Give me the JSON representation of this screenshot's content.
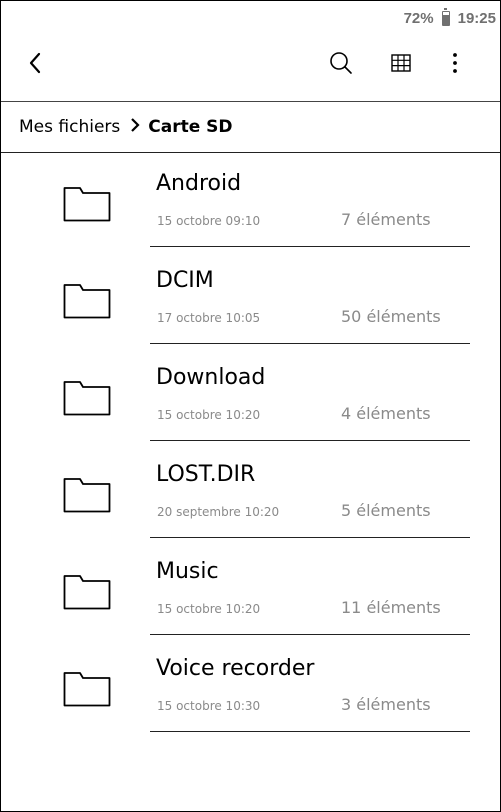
{
  "status_bar": {
    "battery": "72%",
    "time": "19:25"
  },
  "toolbar": {
    "back_icon": "chevron-left-icon",
    "search_icon": "search-icon",
    "view_icon": "grid-view-icon",
    "more_icon": "more-vertical-icon"
  },
  "breadcrumb": {
    "root": "Mes fichiers",
    "current": "Carte SD"
  },
  "files": [
    {
      "name": "Android",
      "date": "15 octobre 09:10",
      "count": "7 éléments"
    },
    {
      "name": "DCIM",
      "date": "17 octobre 10:05",
      "count": "50 éléments"
    },
    {
      "name": "Download",
      "date": "15 octobre 10:20",
      "count": "4 éléments"
    },
    {
      "name": "LOST.DIR",
      "date": "20 septembre 10:20",
      "count": "5 éléments"
    },
    {
      "name": "Music",
      "date": "15 octobre 10:20",
      "count": "11 éléments"
    },
    {
      "name": "Voice recorder",
      "date": "15 octobre 10:30",
      "count": "3 éléments"
    }
  ]
}
